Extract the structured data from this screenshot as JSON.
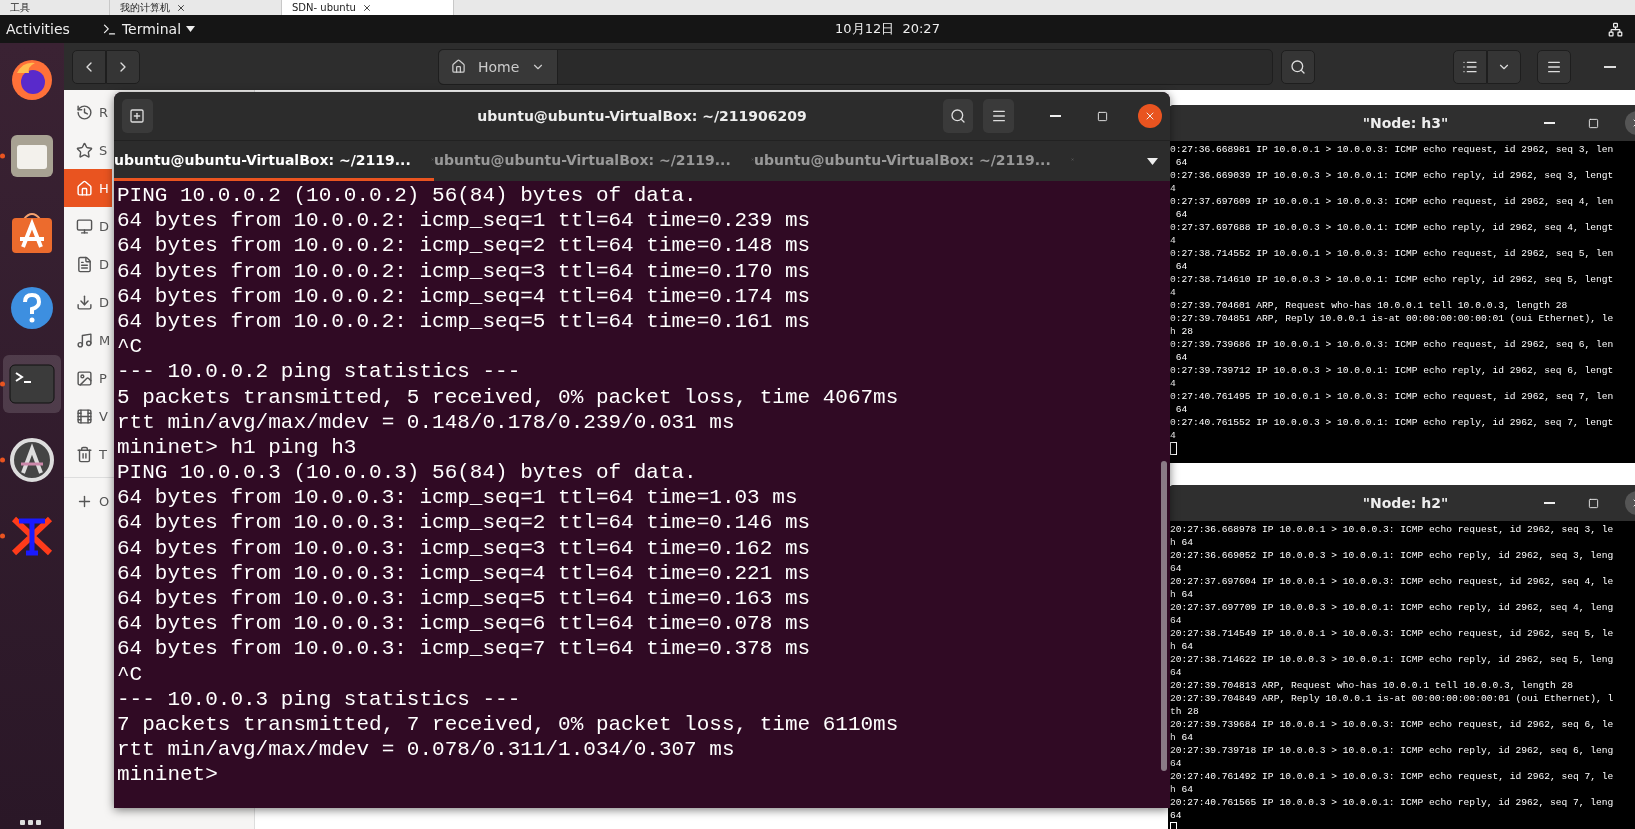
{
  "host_tabs": [
    {
      "label": "工具",
      "selected": false
    },
    {
      "label": "我的计算机",
      "selected": false
    },
    {
      "label": "SDN- ubuntu",
      "selected": true
    }
  ],
  "top_bar": {
    "activities": "Activities",
    "app_menu": "Terminal",
    "clock": "10月12日  20:27"
  },
  "dock": [
    {
      "kind": "firefox",
      "running": false,
      "selected": false
    },
    {
      "kind": "files",
      "running": true,
      "selected": false
    },
    {
      "kind": "store",
      "running": false,
      "selected": false
    },
    {
      "kind": "help",
      "running": false,
      "selected": false
    },
    {
      "kind": "terminal",
      "running": true,
      "selected": true
    },
    {
      "kind": "updater",
      "running": true,
      "selected": false
    },
    {
      "kind": "tex",
      "running": true,
      "selected": false
    }
  ],
  "files": {
    "path": "Home",
    "sidebar": [
      {
        "kind": "recent",
        "label": "R",
        "selected": false
      },
      {
        "kind": "starred",
        "label": "S",
        "selected": false
      },
      {
        "kind": "home",
        "label": "H",
        "selected": true
      },
      {
        "kind": "desktop",
        "label": "D",
        "selected": false
      },
      {
        "kind": "documents",
        "label": "D",
        "selected": false
      },
      {
        "kind": "downloads",
        "label": "D",
        "selected": false
      },
      {
        "kind": "music",
        "label": "M",
        "selected": false
      },
      {
        "kind": "pictures",
        "label": "P",
        "selected": false
      },
      {
        "kind": "videos",
        "label": "V",
        "selected": false
      },
      {
        "kind": "trash",
        "label": "T",
        "selected": false
      },
      {
        "kind": "other",
        "label": "O",
        "selected": false
      }
    ]
  },
  "terminal": {
    "title": "ubuntu@ubuntu-VirtualBox: ~/211906209",
    "tabs": [
      {
        "label": "ubuntu@ubuntu-VirtualBox: ~/2119...",
        "selected": true
      },
      {
        "label": "ubuntu@ubuntu-VirtualBox: ~/2119...",
        "selected": false
      },
      {
        "label": "ubuntu@ubuntu-VirtualBox: ~/2119...",
        "selected": false
      }
    ],
    "lines": [
      "PING 10.0.0.2 (10.0.0.2) 56(84) bytes of data.",
      "64 bytes from 10.0.0.2: icmp_seq=1 ttl=64 time=0.239 ms",
      "64 bytes from 10.0.0.2: icmp_seq=2 ttl=64 time=0.148 ms",
      "64 bytes from 10.0.0.2: icmp_seq=3 ttl=64 time=0.170 ms",
      "64 bytes from 10.0.0.2: icmp_seq=4 ttl=64 time=0.174 ms",
      "64 bytes from 10.0.0.2: icmp_seq=5 ttl=64 time=0.161 ms",
      "^C",
      "--- 10.0.0.2 ping statistics ---",
      "5 packets transmitted, 5 received, 0% packet loss, time 4067ms",
      "rtt min/avg/max/mdev = 0.148/0.178/0.239/0.031 ms",
      "mininet> h1 ping h3",
      "PING 10.0.0.3 (10.0.0.3) 56(84) bytes of data.",
      "64 bytes from 10.0.0.3: icmp_seq=1 ttl=64 time=1.03 ms",
      "64 bytes from 10.0.0.3: icmp_seq=2 ttl=64 time=0.146 ms",
      "64 bytes from 10.0.0.3: icmp_seq=3 ttl=64 time=0.162 ms",
      "64 bytes from 10.0.0.3: icmp_seq=4 ttl=64 time=0.221 ms",
      "64 bytes from 10.0.0.3: icmp_seq=5 ttl=64 time=0.163 ms",
      "64 bytes from 10.0.0.3: icmp_seq=6 ttl=64 time=0.078 ms",
      "64 bytes from 10.0.0.3: icmp_seq=7 ttl=64 time=0.378 ms",
      "^C",
      "--- 10.0.0.3 ping statistics ---",
      "7 packets transmitted, 7 received, 0% packet loss, time 6110ms",
      "rtt min/avg/max/mdev = 0.078/0.311/1.034/0.307 ms",
      "mininet>"
    ]
  },
  "nodes": [
    {
      "title": "\"Node: h3\"",
      "lines": [
        "0:27:36.668981 IP 10.0.0.1 > 10.0.0.3: ICMP echo request, id 2962, seq 3, len",
        " 64",
        "0:27:36.669039 IP 10.0.0.3 > 10.0.0.1: ICMP echo reply, id 2962, seq 3, lengt",
        "4",
        "0:27:37.697609 IP 10.0.0.1 > 10.0.0.3: ICMP echo request, id 2962, seq 4, len",
        " 64",
        "0:27:37.697688 IP 10.0.0.3 > 10.0.0.1: ICMP echo reply, id 2962, seq 4, lengt",
        "4",
        "0:27:38.714552 IP 10.0.0.1 > 10.0.0.3: ICMP echo request, id 2962, seq 5, len",
        " 64",
        "0:27:38.714610 IP 10.0.0.3 > 10.0.0.1: ICMP echo reply, id 2962, seq 5, lengt",
        "4",
        "0:27:39.704601 ARP, Request who-has 10.0.0.1 tell 10.0.0.3, length 28",
        "0:27:39.704851 ARP, Reply 10.0.0.1 is-at 00:00:00:00:00:01 (oui Ethernet), le",
        "h 28",
        "0:27:39.739686 IP 10.0.0.1 > 10.0.0.3: ICMP echo request, id 2962, seq 6, len",
        " 64",
        "0:27:39.739712 IP 10.0.0.3 > 10.0.0.1: ICMP echo reply, id 2962, seq 6, lengt",
        "4",
        "0:27:40.761495 IP 10.0.0.1 > 10.0.0.3: ICMP echo request, id 2962, seq 7, len",
        " 64",
        "0:27:40.761552 IP 10.0.0.3 > 10.0.0.1: ICMP echo reply, id 2962, seq 7, lengt",
        "4"
      ]
    },
    {
      "title": "\"Node: h2\"",
      "lines": [
        "20:27:36.668978 IP 10.0.0.1 > 10.0.0.3: ICMP echo request, id 2962, seq 3, le",
        "h 64",
        "20:27:36.669052 IP 10.0.0.3 > 10.0.0.1: ICMP echo reply, id 2962, seq 3, leng",
        "64",
        "20:27:37.697604 IP 10.0.0.1 > 10.0.0.3: ICMP echo request, id 2962, seq 4, le",
        "h 64",
        "20:27:37.697709 IP 10.0.0.3 > 10.0.0.1: ICMP echo reply, id 2962, seq 4, leng",
        "64",
        "20:27:38.714549 IP 10.0.0.1 > 10.0.0.3: ICMP echo request, id 2962, seq 5, le",
        "h 64",
        "20:27:38.714622 IP 10.0.0.3 > 10.0.0.1: ICMP echo reply, id 2962, seq 5, leng",
        "64",
        "20:27:39.704813 ARP, Request who-has 10.0.0.1 tell 10.0.0.3, length 28",
        "20:27:39.704849 ARP, Reply 10.0.0.1 is-at 00:00:00:00:00:01 (oui Ethernet), l",
        "th 28",
        "20:27:39.739684 IP 10.0.0.1 > 10.0.0.3: ICMP echo request, id 2962, seq 6, le",
        "h 64",
        "20:27:39.739718 IP 10.0.0.3 > 10.0.0.1: ICMP echo reply, id 2962, seq 6, leng",
        "64",
        "20:27:40.761492 IP 10.0.0.1 > 10.0.0.3: ICMP echo request, id 2962, seq 7, le",
        "h 64",
        "20:27:40.761565 IP 10.0.0.3 > 10.0.0.1: ICMP echo reply, id 2962, seq 7, leng",
        "64"
      ]
    }
  ]
}
